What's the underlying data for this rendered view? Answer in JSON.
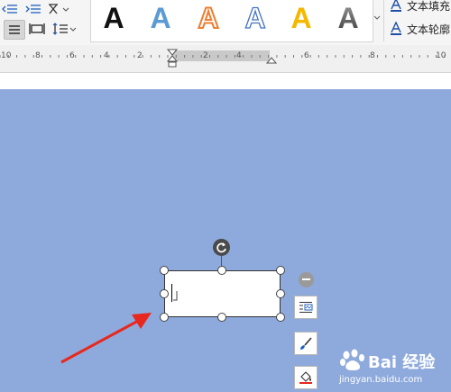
{
  "ribbon": {
    "gallery_letter": "A",
    "styles": [
      {
        "name": "black-solid",
        "fill": "#111111",
        "stroke": "#111111"
      },
      {
        "name": "blue-solid",
        "fill": "#5b9bd5",
        "stroke": "#5b9bd5"
      },
      {
        "name": "orange-outline",
        "fill": "#ffffff",
        "stroke": "#ed7d31"
      },
      {
        "name": "blue-outline",
        "fill": "#ffffff",
        "stroke": "#4472c4"
      },
      {
        "name": "gold-solid",
        "fill": "#f5b800",
        "stroke": "#f5b800"
      },
      {
        "name": "gray-gradient",
        "fill": "#6b6b6b",
        "stroke": "#6b6b6b"
      }
    ],
    "text_fill_label": "文本填充",
    "text_outline_label": "文本轮廓"
  },
  "ruler": {
    "numbers": [
      "10",
      "8",
      "6",
      "4",
      "2",
      "2",
      "4",
      "6",
      "8",
      "10"
    ]
  },
  "colors": {
    "canvas": "#8eaadc",
    "arrow": "#e8281e"
  },
  "watermark": {
    "brand": "Bai 经验",
    "url": "jingyan.baidu.com"
  }
}
